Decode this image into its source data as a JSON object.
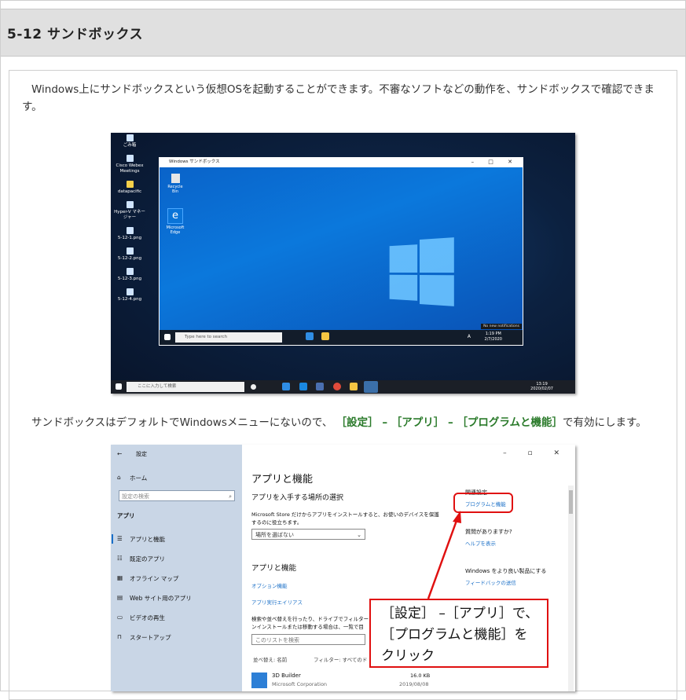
{
  "section": {
    "title": "5-12 サンドボックス"
  },
  "para1": "Windows上にサンドボックスという仮想OSを起動することができます。不審なソフトなどの動作を、サンドボックスで確認できます。",
  "para2": {
    "before": "サンドボックスはデフォルトでWindowsメニューにないので、",
    "path1": "［設定］",
    "sep1": " – ",
    "path2": "［アプリ］",
    "sep2": " – ",
    "path3": "［プログラムと機能］",
    "after": "で有効にします。"
  },
  "desktop": {
    "icons": [
      "ごみ箱",
      "Cisco Webex Meetings",
      "datapacific",
      "Hyper-V マネージャー",
      "5-12-1.png",
      "5-12-2.png",
      "5-12-3.png",
      "5-12-4.png"
    ],
    "host_search_placeholder": "ここに入力して検索",
    "host_time": "13:19",
    "host_date": "2020/02/07",
    "sandbox_window": {
      "title": "Windows サンドボックス",
      "controls": "–  □  ✕",
      "recycle_label": "Recycle Bin",
      "edge_label": "Microsoft Edge",
      "search_placeholder": "Type here to search",
      "time": "1:19 PM",
      "date": "2/7/2020",
      "notification": "No new notifications",
      "tray_lang": "A"
    }
  },
  "settings": {
    "title": "設定",
    "controls": "–  ▫  ✕",
    "sidebar": {
      "home": "ホーム",
      "search_placeholder": "設定の検索",
      "category": "アプリ",
      "items": [
        "アプリと機能",
        "既定のアプリ",
        "オフライン マップ",
        "Web サイト用のアプリ",
        "ビデオの再生",
        "スタートアップ"
      ]
    },
    "main": {
      "heading": "アプリと機能",
      "source_heading": "アプリを入手する場所の選択",
      "source_desc_1": "Microsoft Store だけからアプリをインストールすると、お使いのデバイスを保護",
      "source_desc_2": "するのに役立ちます。",
      "dropdown_value": "場所を選ばない",
      "apps_heading": "アプリと機能",
      "optional_link": "オプション機能",
      "alias_link": "アプリ実行エイリアス",
      "search_desc_1": "検索や並べ替えを行ったり、ドライブでフィルターを",
      "search_desc_2": "ンインストールまたは移動する場合は、一覧で目",
      "list_search_placeholder": "このリストを検索",
      "sort_label": "並べ替え: 名前",
      "filter_label": "フィルター: すべてのド",
      "app_name": "3D Builder",
      "app_publisher": "Microsoft Corporation",
      "app_size": "16.0 KB",
      "app_date": "2019/08/08",
      "related_heading": "関連設定",
      "programs_link": "プログラムと機能",
      "question_heading": "質問がありますか?",
      "help_link": "ヘルプを表示",
      "improve_heading": "Windows をより良い製品にする",
      "feedback_link": "フィードバックの送信"
    }
  },
  "callout": {
    "line1": "［設定］ –［アプリ］で、",
    "line2": "［プログラムと機能］を",
    "line3": "クリック"
  },
  "colors": {
    "highlight": "#2a7a2a",
    "annotation": "#e01010",
    "link": "#1a6fc7"
  }
}
